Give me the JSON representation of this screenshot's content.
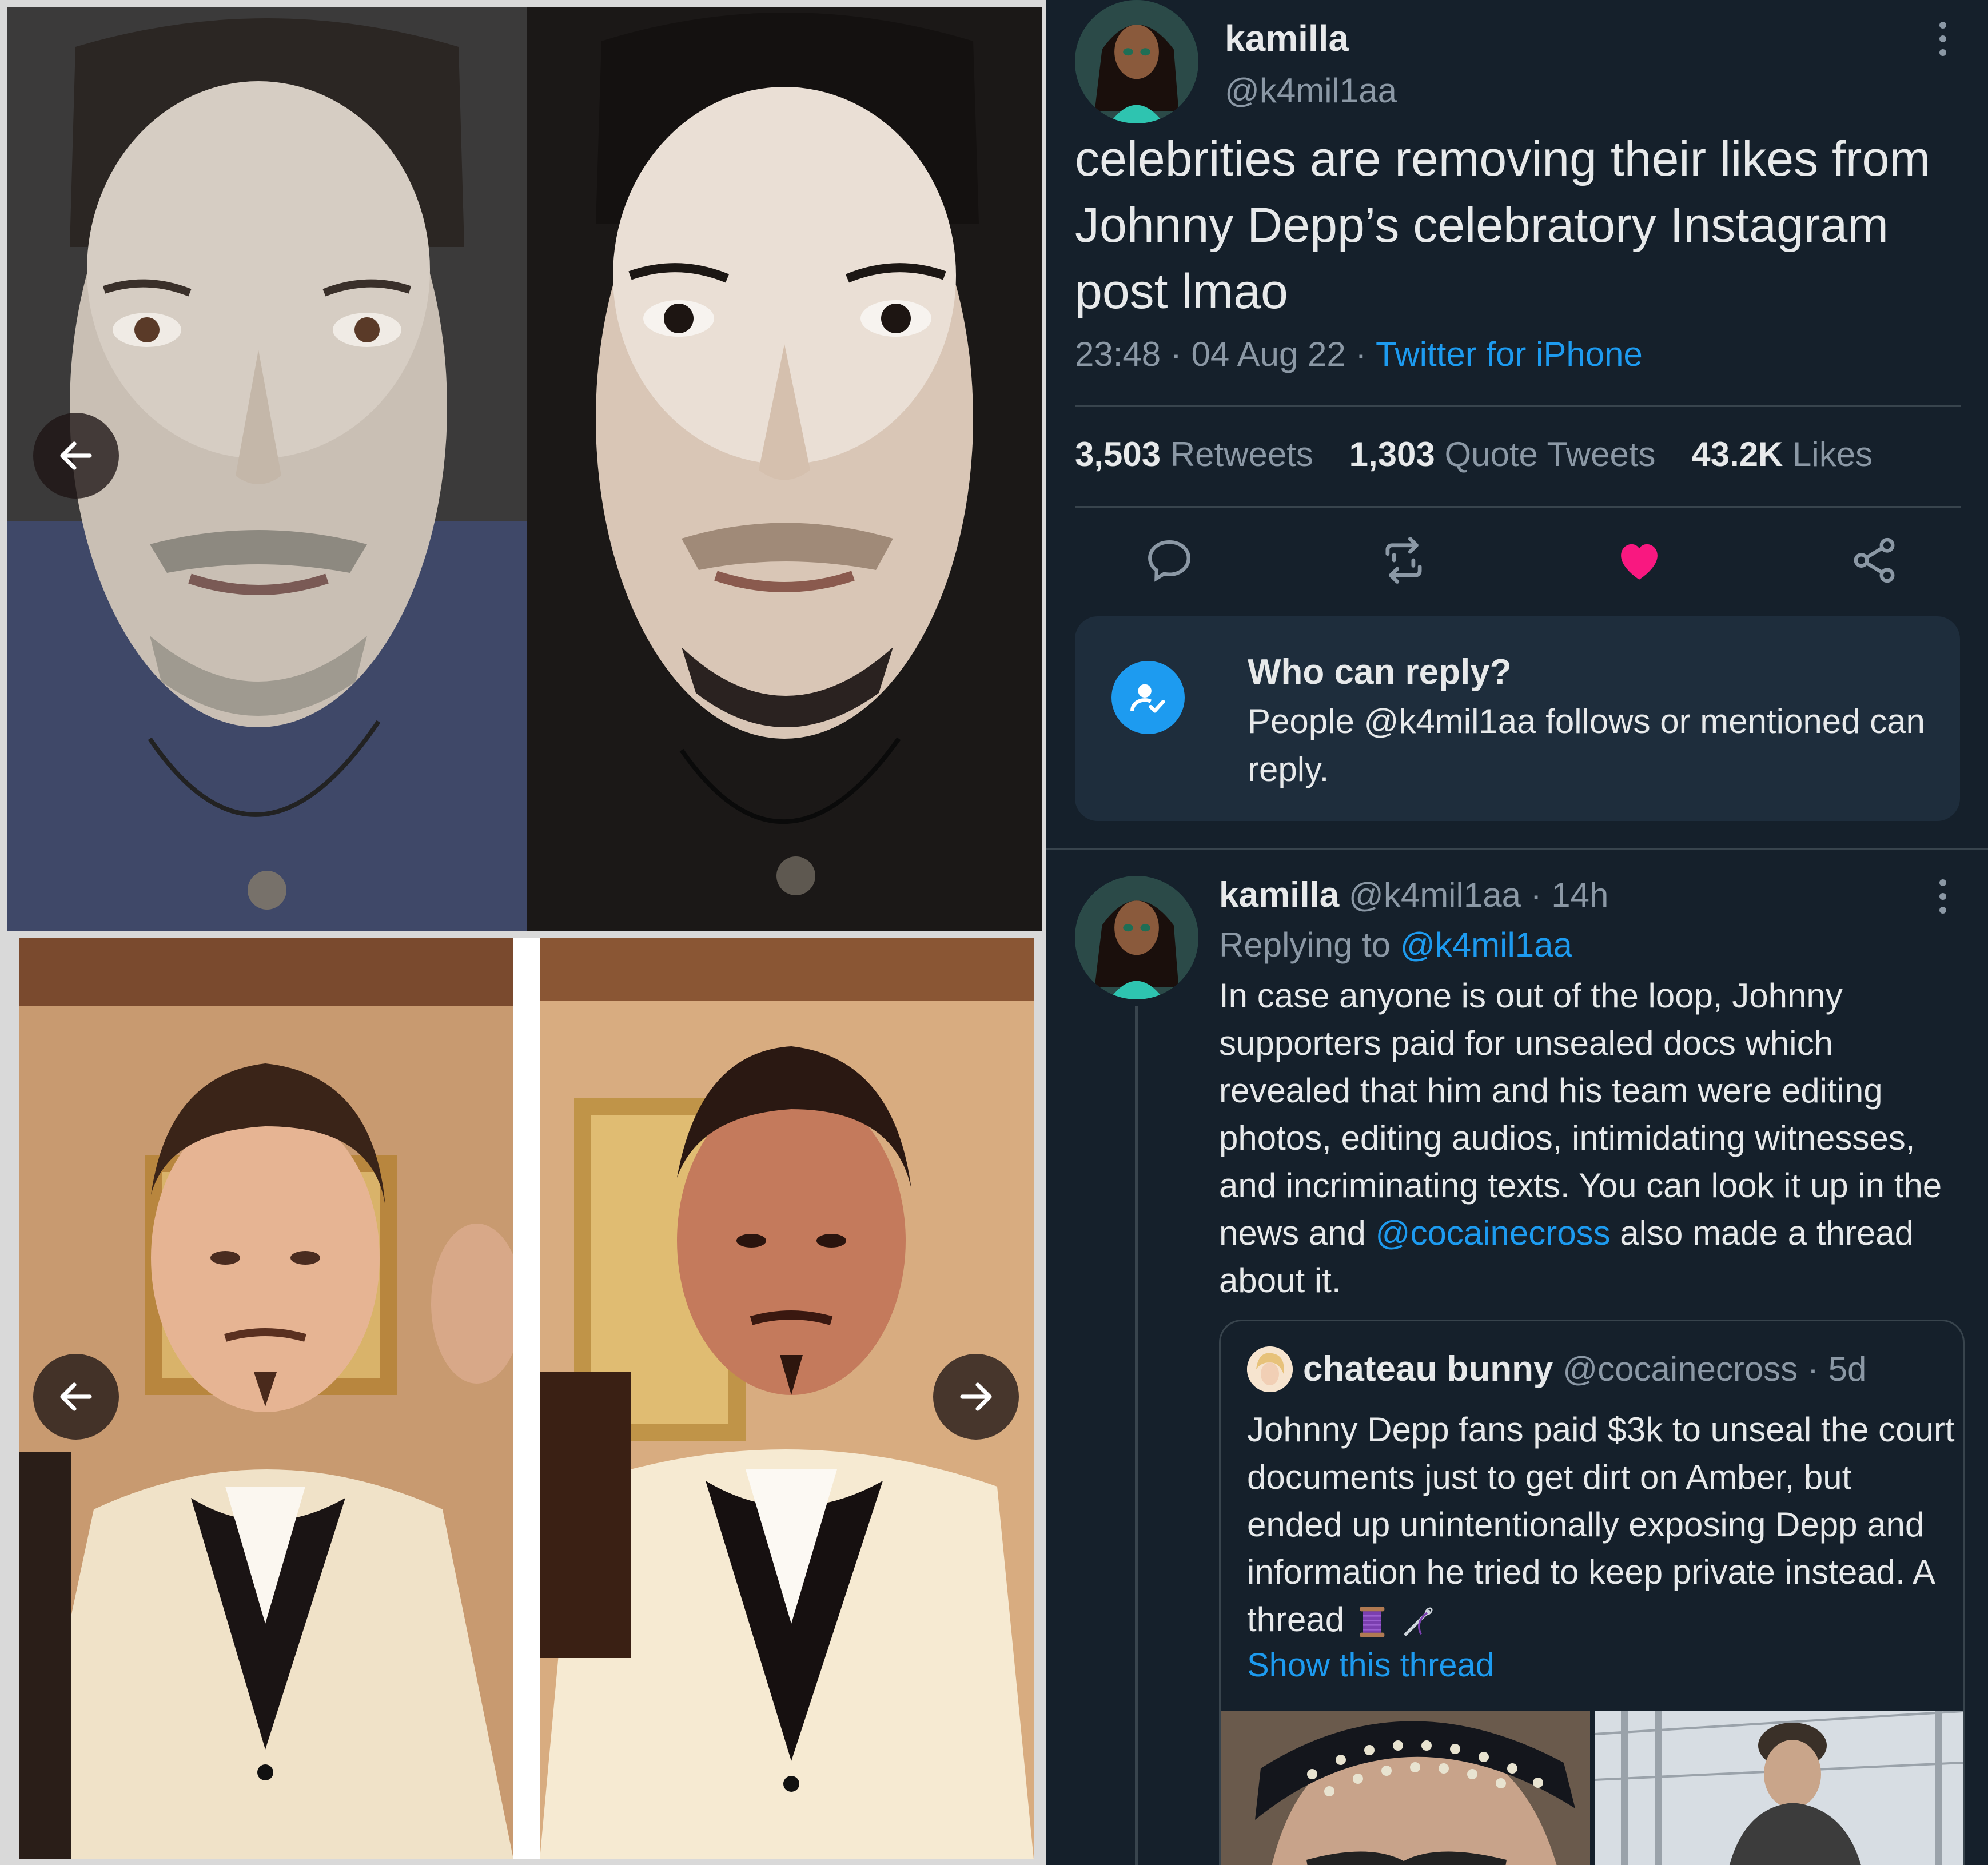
{
  "collage": {
    "nav_buttons": [
      "arrow-left-icon",
      "arrow-left-icon",
      "arrow-right-icon"
    ]
  },
  "tweet": {
    "display_name": "kamilla",
    "handle": "@k4mil1aa",
    "text": "celebrities are removing their likes from Johnny Depp’s celebratory Instagram post lmao",
    "time": "23:48",
    "date": "04 Aug 22",
    "source": "Twitter for iPhone",
    "stats": {
      "retweets_count": "3,503",
      "retweets_label": "Retweets",
      "quotes_count": "1,303",
      "quotes_label": "Quote Tweets",
      "likes_count": "43.2K",
      "likes_label": "Likes"
    },
    "actions": [
      "reply-icon",
      "retweet-icon",
      "like-icon",
      "share-icon"
    ],
    "like_color": "#f91880"
  },
  "who_can_reply": {
    "title": "Who can reply?",
    "text": "People @k4mil1aa follows or mentioned can reply."
  },
  "reply": {
    "display_name": "kamilla",
    "handle": "@k4mil1aa",
    "age": "14h",
    "replying_label": "Replying to",
    "replying_to": "@k4mil1aa",
    "text_before": "In case anyone is out of the loop, Johnny supporters paid for unsealed docs which revealed that him and his team were editing photos, editing audios, intimidating witnesses, and incriminating texts. You can look it up in the news and",
    "mention": "@cocainecross",
    "text_after": "also made a thread about it."
  },
  "quoted": {
    "display_name": "chateau bunny",
    "handle": "@cocainecross",
    "age": "5d",
    "text": "Johnny Depp fans paid $3k to unseal the court documents just to get dirt on Amber, but ended up unintentionally exposing Depp and information he tried to keep private instead. A thread",
    "emojis": [
      "thread-spool-icon",
      "needle-icon"
    ],
    "show_thread": "Show this thread"
  },
  "colors": {
    "background": "#15202b",
    "accent": "#1d9bf0",
    "secondary_text": "#8b98a5",
    "divider": "#38444d"
  }
}
